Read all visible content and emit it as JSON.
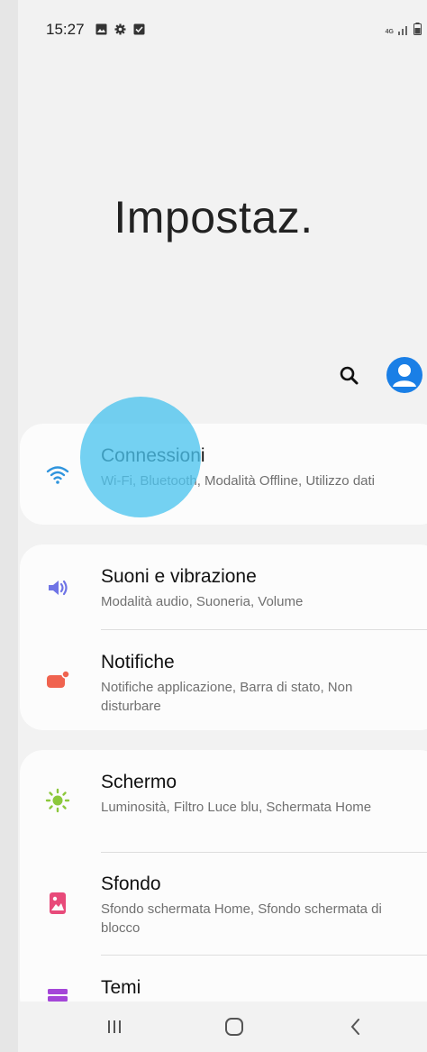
{
  "status_bar": {
    "time": "15:27",
    "left_icons": [
      "image-icon",
      "gear-icon",
      "check-square-icon"
    ],
    "network": "4G",
    "right_icons": [
      "signal-icon",
      "battery-icon"
    ]
  },
  "header": {
    "title": "Impostaz."
  },
  "actions": {
    "search_icon": "search-icon",
    "account_icon": "account-icon",
    "accent": "#1a7fe6"
  },
  "settings": {
    "connections": {
      "title": "Connessioni",
      "subtitle": "Wi-Fi, Bluetooth, Modalità Offline, Utilizzo dati",
      "icon": "wifi-icon"
    },
    "sounds": {
      "title": "Suoni e vibrazione",
      "subtitle": "Modalità audio, Suoneria, Volume",
      "icon": "volume-icon"
    },
    "notifications": {
      "title": "Notifiche",
      "subtitle": "Notifiche applicazione, Barra di stato, Non disturbare",
      "icon": "notification-icon"
    },
    "display": {
      "title": "Schermo",
      "subtitle": "Luminosità, Filtro Luce blu, Schermata Home",
      "icon": "brightness-icon"
    },
    "wallpaper": {
      "title": "Sfondo",
      "subtitle": "Sfondo schermata Home, Sfondo schermata di blocco",
      "icon": "wallpaper-icon"
    },
    "themes": {
      "title": "Temi",
      "icon": "themes-icon"
    }
  },
  "nav_bar": {
    "recent_icon": "recents-icon",
    "home_icon": "home-icon",
    "back_icon": "back-icon"
  }
}
